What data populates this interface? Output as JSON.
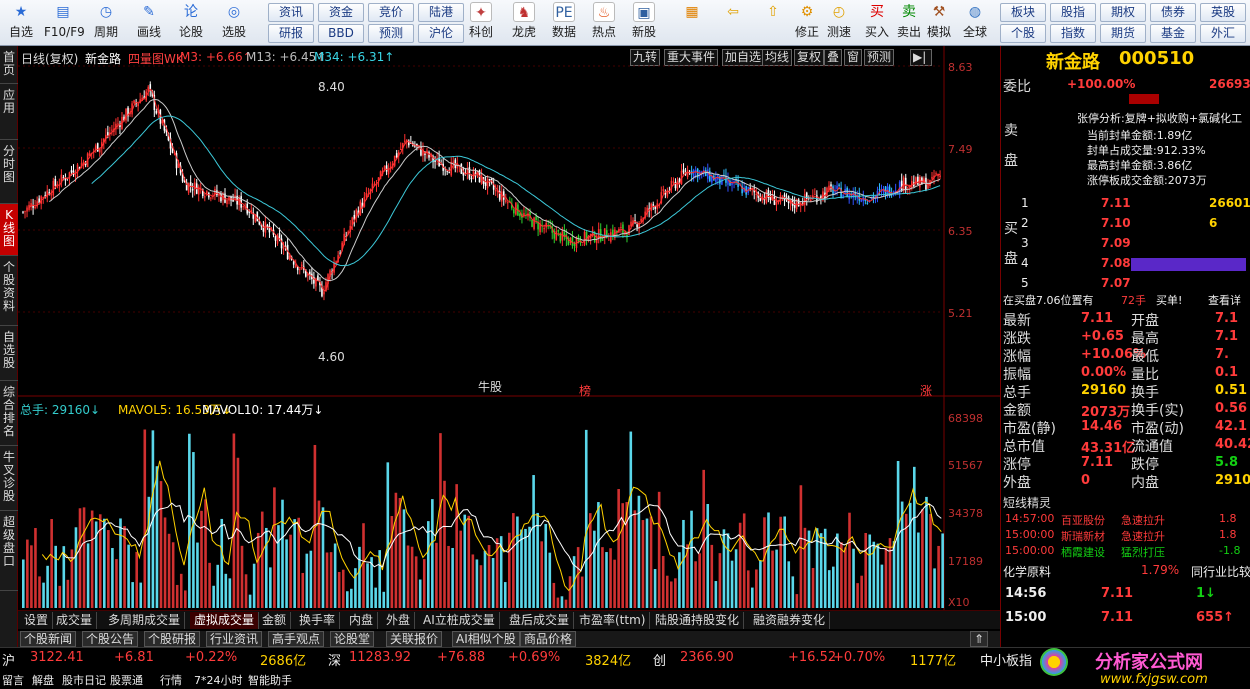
{
  "toolbar": {
    "icons": [
      {
        "label": "自选",
        "icon": "star-icon"
      },
      {
        "label": "F10/F9",
        "icon": "f10-icon"
      },
      {
        "label": "周期",
        "icon": "clock-icon"
      },
      {
        "label": "画线",
        "icon": "pen-icon"
      },
      {
        "label": "论股",
        "icon": "forum-icon"
      },
      {
        "label": "选股",
        "icon": "select-stock-icon"
      }
    ],
    "buttons": [
      "资讯",
      "资金",
      "竞价",
      "陆港",
      "研报",
      "BBD",
      "预测",
      "沪伦"
    ],
    "icons2": [
      {
        "label": "科创",
        "icon": "star-market-icon"
      },
      {
        "label": "龙虎",
        "icon": "dragon-tiger-icon"
      },
      {
        "label": "数据",
        "icon": "pe-data-icon"
      },
      {
        "label": "热点",
        "icon": "hot-icon"
      },
      {
        "label": "新股",
        "icon": "new-stock-icon"
      }
    ],
    "icons3": [
      {
        "label": "",
        "icon": "grid-icon"
      },
      {
        "label": "",
        "icon": "back-arrow-icon"
      },
      {
        "label": "",
        "icon": "up-arrow-icon"
      },
      {
        "label": "修正",
        "icon": "fix-icon"
      },
      {
        "label": "测速",
        "icon": "speed-icon"
      },
      {
        "label": "买入",
        "icon": "buy-icon"
      },
      {
        "label": "卖出",
        "icon": "sell-icon"
      },
      {
        "label": "模拟",
        "icon": "hammer-icon"
      },
      {
        "label": "全球",
        "icon": "globe-icon"
      }
    ],
    "buttons2": [
      "板块",
      "股指",
      "期权",
      "债券",
      "英股",
      "个股",
      "指数",
      "期货",
      "基金",
      "外汇"
    ]
  },
  "lefttabs": [
    "首页",
    "应用",
    "分时图",
    "K线图",
    "个股资料",
    "自选股",
    "综合排名",
    "牛叉诊股",
    "超级盘口"
  ],
  "chart_header": {
    "title": "日线(复权)",
    "name": "新金路",
    "ind": "四量图WK",
    "m3": "M3: +6.66↑",
    "m13": "M13: +6.45↑",
    "m34": "M34: +6.31↑"
  },
  "chart_buttons": [
    "九转",
    "重大事件",
    "加自选",
    "均线",
    "复权",
    "叠",
    "窗",
    "预测"
  ],
  "yaxis": [
    "8.63",
    "7.49",
    "6.35",
    "5.21"
  ],
  "vaxis": [
    "68398",
    "51567",
    "34378",
    "17189",
    "X10"
  ],
  "annotations": {
    "hi": "8.40",
    "lo": "4.60",
    "niu": "牛股",
    "bang": "榜",
    "zhang": "涨"
  },
  "vol_header": {
    "total": "总手: 29160↓",
    "mavol5": "MAVOL5: 16.53万↓",
    "mavol10": "MAVOL10: 17.44万↓"
  },
  "bottom_tabs": [
    "设置",
    "成交量",
    "多周期成交量",
    "虚拟成交量",
    "金额",
    "换手率",
    "内盘",
    "外盘",
    "AI立桩成交量",
    "盘后成交量",
    "市盈率(ttm)",
    "陆股通持股变化",
    "融资融券变化"
  ],
  "news_tabs": [
    "个股新闻",
    "个股公告",
    "个股研报",
    "行业资讯",
    "高手观点",
    "论股堂",
    "关联报价",
    "AI相似个股",
    "商品价格"
  ],
  "right": {
    "name": "新金路",
    "code": "000510",
    "weibi_l": "委比",
    "weibi": "+100.00%",
    "weibi_v": "26693",
    "limit": "张停分析:复牌+拟收购+氯碱化工",
    "seal1": "当前封单金额:1.89亿",
    "seal2": "封单占成交量:912.33%",
    "seal3": "最高封单金额:3.86亿",
    "seal4": "涨停板成交金额:2073万",
    "sell": "卖盘",
    "buy": "买盘",
    "book": [
      [
        "1",
        "7.11",
        "26601"
      ],
      [
        "2",
        "7.10",
        "6"
      ],
      [
        "3",
        "7.09",
        ""
      ],
      [
        "4",
        "7.08",
        ""
      ],
      [
        "5",
        "7.07",
        ""
      ]
    ],
    "atbuy": "在买盘7.06位置有",
    "atbuyv": "72手",
    "buyexc": "买单!",
    "more": "查看详",
    "quote": [
      [
        "最新",
        "7.11",
        "开盘",
        "7.1"
      ],
      [
        "涨跌",
        "+0.65",
        "最高",
        "7.1"
      ],
      [
        "涨幅",
        "+10.06%",
        "最低",
        "7."
      ],
      [
        "振幅",
        "0.00%",
        "量比",
        "0.1"
      ],
      [
        "总手",
        "29160",
        "换手",
        "0.51"
      ],
      [
        "金额",
        "2073万",
        "换手(实)",
        "0.56"
      ],
      [
        "市盈(静)",
        "14.46",
        "市盈(动)",
        "42.1"
      ],
      [
        "总市值",
        "43.31亿",
        "流通值",
        "40.42"
      ],
      [
        "涨停",
        "7.11",
        "跌停",
        "5.8"
      ],
      [
        "外盘",
        "0",
        "内盘",
        "2910"
      ]
    ],
    "sprite_title": "短线精灵",
    "sprites": [
      [
        "14:57:00",
        "百亚股份",
        "急速拉升",
        "1.8"
      ],
      [
        "15:00:00",
        "斯瑞新材",
        "急速拉升",
        "1.8"
      ],
      [
        "15:00:00",
        "栖霞建设",
        "猛烈打压",
        "-1.8"
      ]
    ],
    "ind": "化学原料",
    "ind_pct": "1.79%",
    "ind_cmp": "同行业比较",
    "ticks": [
      [
        "14:56",
        "7.11",
        "1↓"
      ],
      [
        "15:00",
        "7.11",
        "655↑"
      ]
    ]
  },
  "status": {
    "sh": "沪",
    "sh_v": "3122.41",
    "sh_c": "+6.81",
    "sh_p": "+0.22%",
    "sh_a": "2686亿",
    "sz": "深",
    "sz_v": "11283.92",
    "sz_c": "+76.88",
    "sz_p": "+0.69%",
    "sz_a": "3824亿",
    "cy": "创",
    "cy_v": "2366.90",
    "cy_c": "+16.52",
    "cy_p": "+0.70%",
    "cy_a": "1177亿",
    "small": "中小板指",
    "bottom": [
      "留言",
      "解盘",
      "股市日记",
      "股票通",
      "行情",
      "7*24小时",
      "智能助手"
    ],
    "brand": "分析家公式网",
    "url": "www.fxjgsw.com"
  }
}
